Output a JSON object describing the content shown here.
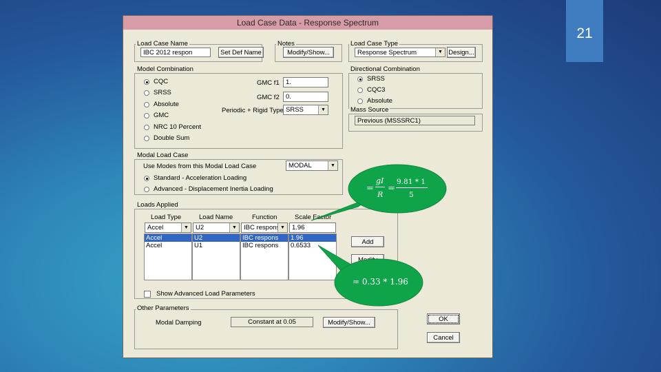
{
  "slide": {
    "number": "21"
  },
  "dialog": {
    "title": "Load Case Data - Response Spectrum",
    "load_case_name": {
      "legend": "Load Case Name",
      "value": "IBC 2012 respon",
      "set_def_button": "Set Def Name"
    },
    "notes": {
      "legend": "Notes",
      "modify_button": "Modify/Show..."
    },
    "load_case_type": {
      "legend": "Load Case Type",
      "value": "Response Spectrum",
      "design_button": "Design..."
    },
    "modal_combination": {
      "legend": "Model Combination",
      "options": [
        "CQC",
        "SRSS",
        "Absolute",
        "GMC",
        "NRC 10 Percent",
        "Double Sum"
      ],
      "selected_index": 0,
      "gmc_f1_label": "GMC  f1",
      "gmc_f1_value": "1.",
      "gmc_f2_label": "GMC  f2",
      "gmc_f2_value": "0.",
      "periodic_label": "Periodic + Rigid Type",
      "periodic_value": "SRSS"
    },
    "directional_combination": {
      "legend": "Directional Combination",
      "options": [
        "SRSS",
        "CQC3",
        "Absolute"
      ],
      "selected_index": 0
    },
    "mass_source": {
      "legend": "Mass Source",
      "value": "Previous (MSSSRC1)"
    },
    "modal_load_case": {
      "legend": "Modal Load Case",
      "use_modes_label": "Use Modes from this Modal Load Case",
      "modal_value": "MODAL",
      "options": [
        "Standard - Acceleration Loading",
        "Advanced - Displacement Inertia Loading"
      ],
      "selected_index": 0
    },
    "loads_applied": {
      "legend": "Loads Applied",
      "headers": [
        "Load Type",
        "Load Name",
        "Function",
        "Scale Factor"
      ],
      "edit_row": [
        "Accel",
        "U2",
        "IBC respons",
        "1.96"
      ],
      "rows": [
        [
          "Accel",
          "U2",
          "IBC respons",
          "1.96"
        ],
        [
          "Accel",
          "U1",
          "IBC respons",
          "0.6533"
        ]
      ],
      "selected_row": 0,
      "add_button": "Add",
      "modify_button": "Modify",
      "show_advanced_label": "Show Advanced Load Parameters"
    },
    "other_parameters": {
      "legend": "Other Parameters",
      "modal_damping_label": "Modal Damping",
      "modal_damping_value": "Constant at 0.05",
      "modify_button": "Modify/Show..."
    },
    "ok_button": "OK",
    "cancel_button": "Cancel"
  },
  "annotations": {
    "top": {
      "prefix": "=",
      "numerator": "gI",
      "denominator": "R",
      "equals": "=",
      "num2": "9.81 * 1",
      "den2": "5",
      "color": "#0fa34a"
    },
    "bottom": {
      "text": "= 0.33 * 1.96",
      "color": "#0fa34a"
    }
  }
}
